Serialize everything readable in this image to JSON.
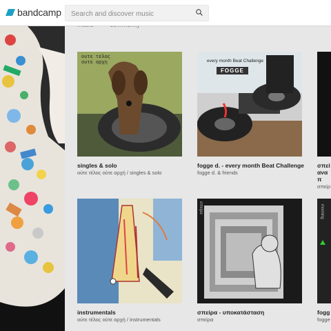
{
  "header": {
    "logo_text": "bandcamp",
    "search_placeholder": "Search and discover music"
  },
  "tabs": {
    "music": "music",
    "community": "community"
  },
  "albums": [
    {
      "title": "singles & solo",
      "subtitle": "ούτε τέλος ούτε αρχή / singles & solo",
      "cover_text": "ουτε τελος ουτε αρχη"
    },
    {
      "title": "fogge d. - every month Beat Challenge",
      "subtitle": "fogge d. & friends",
      "cover_text": "every month Beat Challenge",
      "cover_logo": "FOGGE"
    },
    {
      "title": "σπεί αναπ",
      "subtitle": "σπείρ"
    },
    {
      "title": "instrumentals",
      "subtitle": "ούτε τέλος ούτε αρχή / instrumentals"
    },
    {
      "title": "σπείρα - υποκατάσταση",
      "subtitle": "σπείρα",
      "cover_text": "σπείρα"
    },
    {
      "title": "fogg",
      "subtitle": "fogge",
      "cover_text": "morning"
    }
  ],
  "colors": {
    "accent": "#1da0c3",
    "background": "#e7e7e7"
  }
}
